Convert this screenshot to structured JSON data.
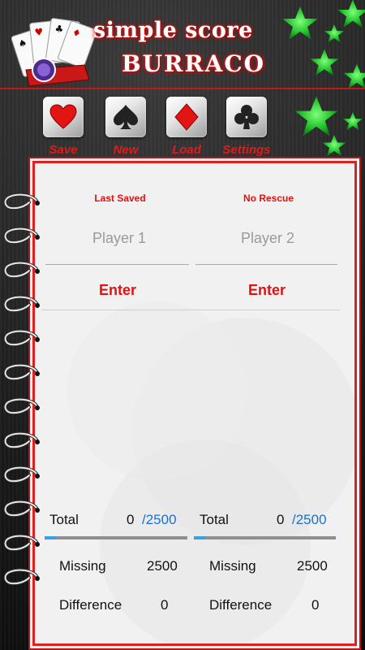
{
  "header": {
    "title_line1": "simple score",
    "title_line2": "BURRACO"
  },
  "toolbar": [
    {
      "label": "Save",
      "icon": "heart-icon"
    },
    {
      "label": "New",
      "icon": "spade-icon"
    },
    {
      "label": "Load",
      "icon": "diamond-icon"
    },
    {
      "label": "Settings",
      "icon": "club-icon"
    }
  ],
  "columns": [
    {
      "header": "Last Saved",
      "player_placeholder": "Player 1",
      "enter_label": "Enter",
      "total_label": "Total",
      "total_value": "0",
      "total_target": "/2500",
      "progress": 0.08,
      "missing_label": "Missing",
      "missing_value": "2500",
      "difference_label": "Difference",
      "difference_value": "0"
    },
    {
      "header": "No Rescue",
      "player_placeholder": "Player 2",
      "enter_label": "Enter",
      "total_label": "Total",
      "total_value": "0",
      "total_target": "/2500",
      "progress": 0.08,
      "missing_label": "Missing",
      "missing_value": "2500",
      "difference_label": "Difference",
      "difference_value": "0"
    }
  ],
  "colors": {
    "accent_red": "#e01212",
    "target_blue": "#1f6fd1",
    "progress_blue": "#3aa0e6",
    "star_green": "#1fbf2a"
  }
}
